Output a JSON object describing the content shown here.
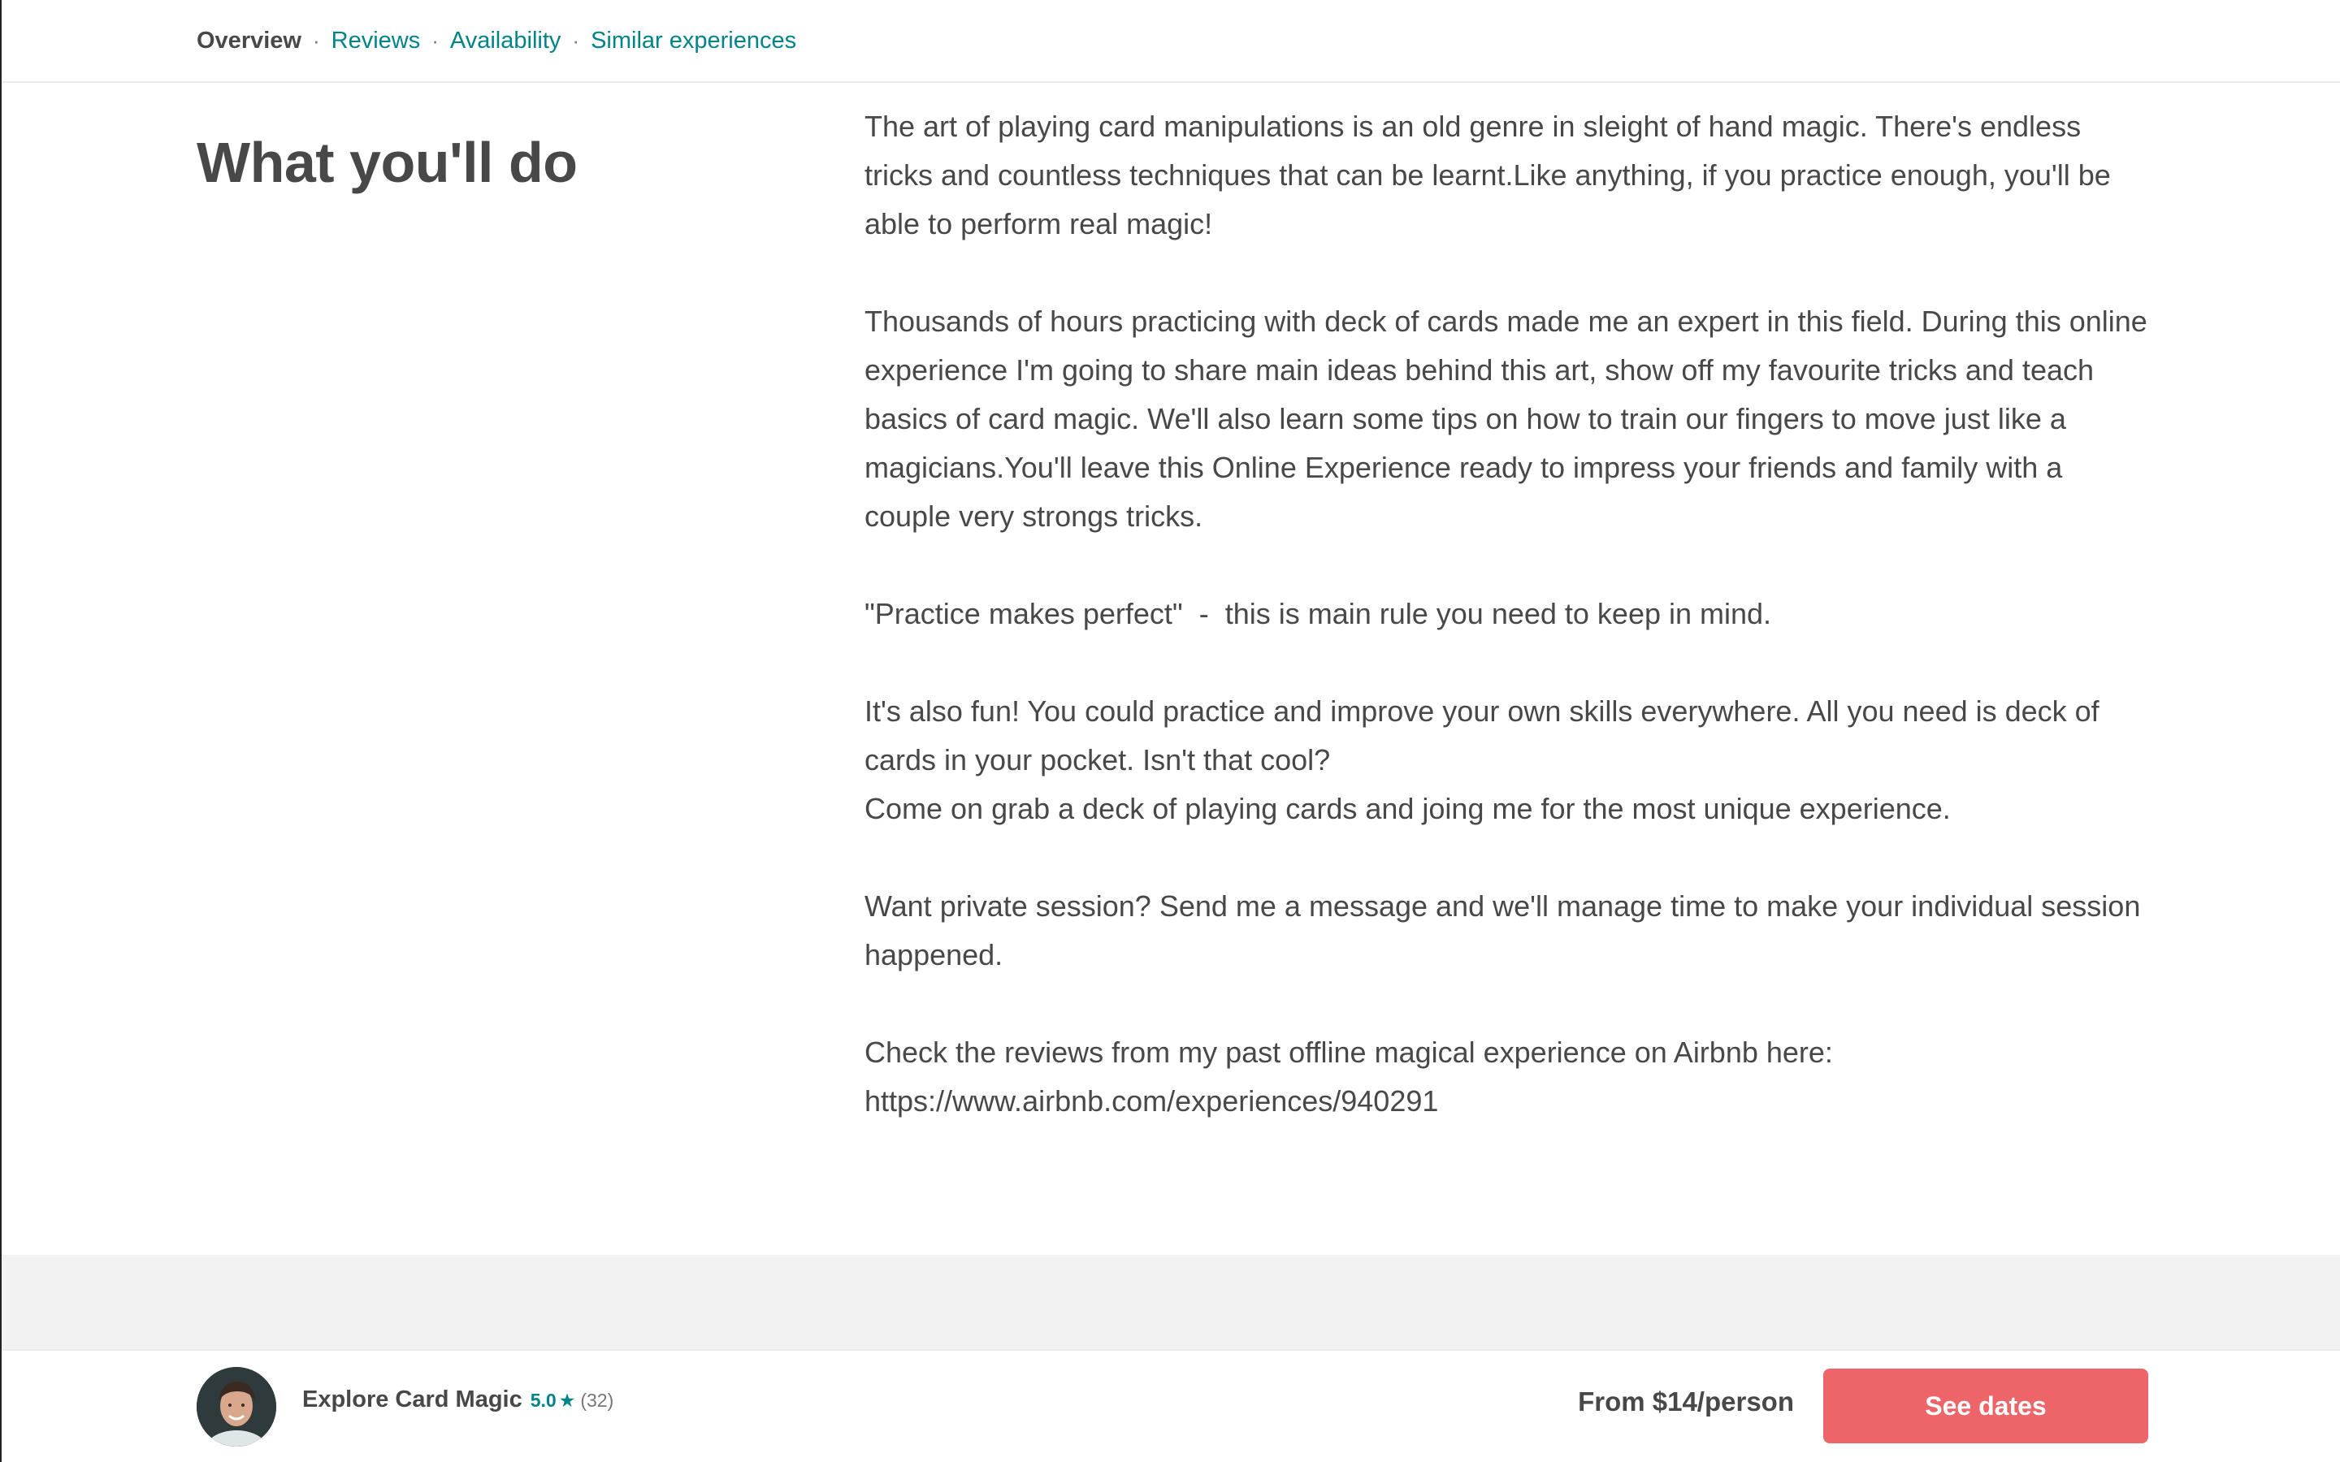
{
  "subnav": {
    "items": [
      {
        "label": "Overview"
      },
      {
        "label": "Reviews"
      },
      {
        "label": "Availability"
      },
      {
        "label": "Similar experiences"
      }
    ],
    "separator": "·"
  },
  "section": {
    "title": "What you'll do",
    "paragraphs": [
      [
        "The art of playing card manipulations is an old genre in sleight of hand magic. There's endless tricks and countless techniques that can be learnt.Like anything, if you practice enough, you'll be able to perform real magic!"
      ],
      [
        "Thousands of hours practicing with deck of cards made me an expert in this field. During this online experience I'm going to share main ideas behind this art, show off my favourite tricks and teach basics of card magic. We'll also learn some tips on how to train our fingers to move just like a magicians.You'll leave this Online Experience ready to impress your friends and family with a couple very strongs tricks."
      ],
      [
        "\"Practice makes perfect\"  -  this is main rule you need to keep in mind."
      ],
      [
        "It's also fun! You could practice and improve your own skills everywhere. All you need is deck of cards in your pocket. Isn't that cool?",
        "Come on grab a deck of playing cards and joing me for the most unique experience."
      ],
      [
        "Want private session? Send me a message and we'll manage time to make your individual session happened."
      ],
      [
        "Check the reviews from my past offline magical experience on Airbnb here:",
        "https://www.airbnb.com/experiences/940291"
      ]
    ]
  },
  "bottom_bar": {
    "title": "Explore Card Magic",
    "rating": "5.0",
    "star_icon": "star-icon",
    "review_count": "(32)",
    "price": "From $14/person",
    "cta_label": "See dates"
  },
  "colors": {
    "accent_teal": "#008489",
    "cta": "#ed6469",
    "text": "#484848"
  }
}
